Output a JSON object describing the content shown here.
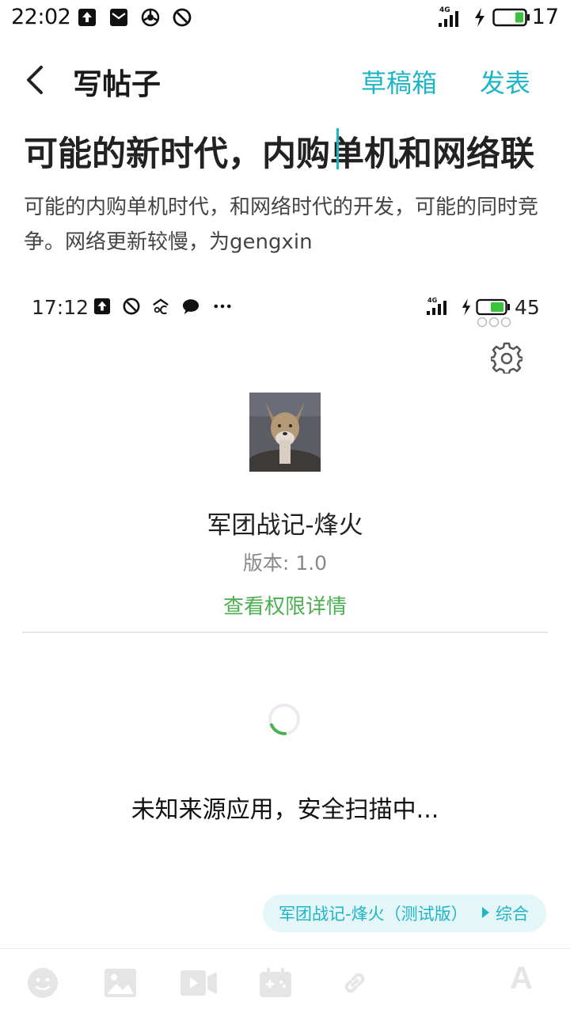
{
  "status_bar": {
    "time": "22:02",
    "icons": [
      "upload-icon",
      "mail-icon",
      "sync-icon",
      "dnd-icon"
    ],
    "network": "4G",
    "battery_level": "17"
  },
  "header": {
    "title": "写帖子",
    "drafts_label": "草稿箱",
    "publish_label": "发表"
  },
  "post": {
    "title": "可能的新时代，内购单机和网络联",
    "body": "可能的内购单机时代，和网络时代的开发，可能的同时竞争。网络更新较慢，为gengxin"
  },
  "embedded_screenshot": {
    "status_time": "17:12",
    "network": "4G",
    "battery_level": "45",
    "app_name": "军团战记-烽火",
    "version": "版本: 1.0",
    "permissions_link": "查看权限详情",
    "scan_status": "未知来源应用，安全扫描中..."
  },
  "tag": {
    "game": "军团战记-烽火（测试版）",
    "category": "综合"
  },
  "toolbar": {
    "items": [
      "emoji-icon",
      "image-icon",
      "video-icon",
      "game-icon",
      "link-icon",
      "font-icon"
    ],
    "font_label": "A"
  },
  "colors": {
    "accent": "#1fb5c6",
    "link_green": "#4caf50",
    "toolbar_icon": "#e5e5e5"
  }
}
